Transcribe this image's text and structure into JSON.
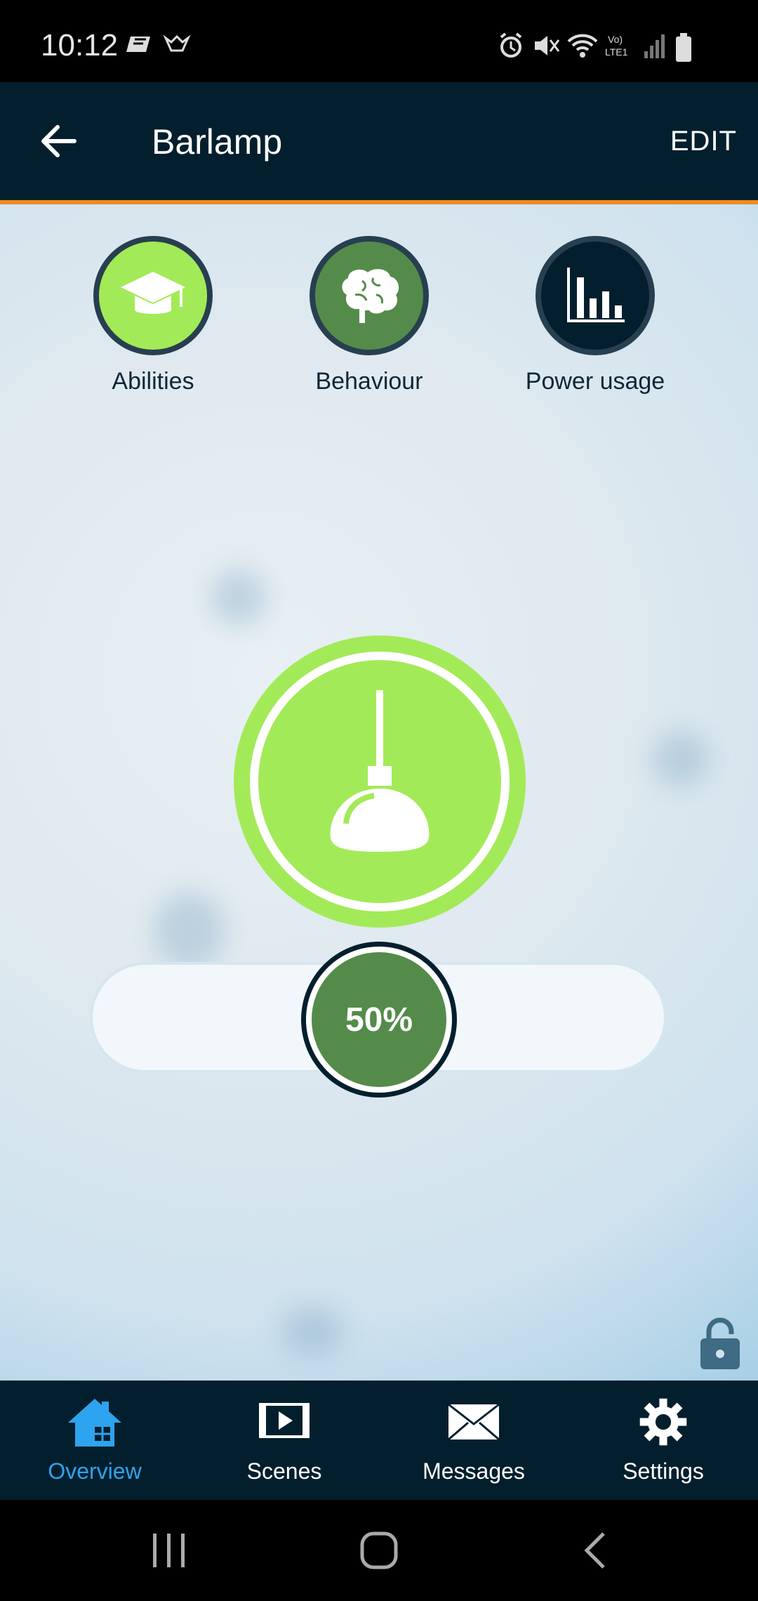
{
  "status_bar": {
    "time": "10:12",
    "icons": [
      "notification-icon",
      "app-icon",
      "alarm-icon",
      "mute-icon",
      "wifi-icon",
      "lte-icon",
      "signal-icon",
      "battery-icon"
    ]
  },
  "app_bar": {
    "title": "Barlamp",
    "edit_label": "EDIT",
    "back_icon": "arrow-left-icon"
  },
  "shortcuts": [
    {
      "label": "Abilities",
      "icon": "graduation-cap-icon",
      "color": "#a3ea58"
    },
    {
      "label": "Behaviour",
      "icon": "brain-icon",
      "color": "#548b4a"
    },
    {
      "label": "Power usage",
      "icon": "bar-chart-icon",
      "color": "#031f2e"
    }
  ],
  "lamp": {
    "icon": "pendant-lamp-icon",
    "color": "#a3ea58",
    "state": "on"
  },
  "dimmer": {
    "value_label": "50%",
    "value": 0.5,
    "knob_color": "#548b4a"
  },
  "lock": {
    "icon": "lock-open-icon"
  },
  "bottom_nav": {
    "items": [
      {
        "label": "Overview",
        "icon": "home-icon",
        "active": true
      },
      {
        "label": "Scenes",
        "icon": "scenes-icon",
        "active": false
      },
      {
        "label": "Messages",
        "icon": "envelope-icon",
        "active": false
      },
      {
        "label": "Settings",
        "icon": "gear-icon",
        "active": false
      }
    ],
    "active_color": "#2ea3ef"
  },
  "system_nav": {
    "icons": [
      "recents-icon",
      "home-button-icon",
      "back-icon"
    ]
  },
  "colors": {
    "app_bar": "#031f2e",
    "accent_orange": "#f08a1d"
  }
}
